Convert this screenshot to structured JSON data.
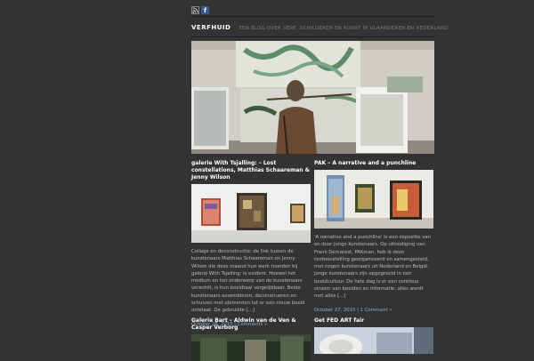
{
  "site": {
    "title": "VERFHUID",
    "tagline": "EEN BLOG OVER VERF, SCHILDEREN EN KUNST IN VLAANDEREN EN NEDERLAND.",
    "icons": [
      "rss-icon",
      "facebook-icon"
    ],
    "fb_letter": "f"
  },
  "posts": [
    {
      "title": "galerie With Tsjalling: – Lost constellations, Matthias Schaareman & Jenny Wilson",
      "excerpt": "Collage en deconstructie: de link tussen de kunstenaars Matthias Schaareman en Jenny Wilson die deze maand hun werk toonden bij galerie With Tsjalling: is evident. Hoewel het medium en het onderwerp van de kunstenaars verschilt, is hun beeldtaal vergelijkbaar. Beide kunstenaars assembleren, deconstrueren en schuiven met elementen tot er een nieuw beeld ontstaat. De gebruikte […]",
      "date": "October 28, 2015",
      "separator": "|",
      "comments": "Comments »"
    },
    {
      "title": "PAK – A narrative and a punchline",
      "excerpt": "'A narrative and a punchline' is een expositie van en door jonge kunstenaars. Op uitnodiging van Frank Demarest, PAKman, heb ik deze tentoonstelling georganiseerd en samengesteld, met negen kunstenaars uit Nederland en België. Jonge kunstenaars zijn opgegroeid in een beeldcultuur. De hele dag is er een continue stroom van beelden en informatie: alles wordt met alles […]",
      "date": "October 27, 2015",
      "separator": "|",
      "comments": "1 Comment »"
    },
    {
      "title": "Galerie Bart – Aldwin van de Ven & Casper Verborg"
    },
    {
      "title": "Get FED ART fair"
    }
  ],
  "colors": {
    "background": "#333333",
    "title": "#ffffff",
    "meta_link": "#8fb3cc"
  }
}
